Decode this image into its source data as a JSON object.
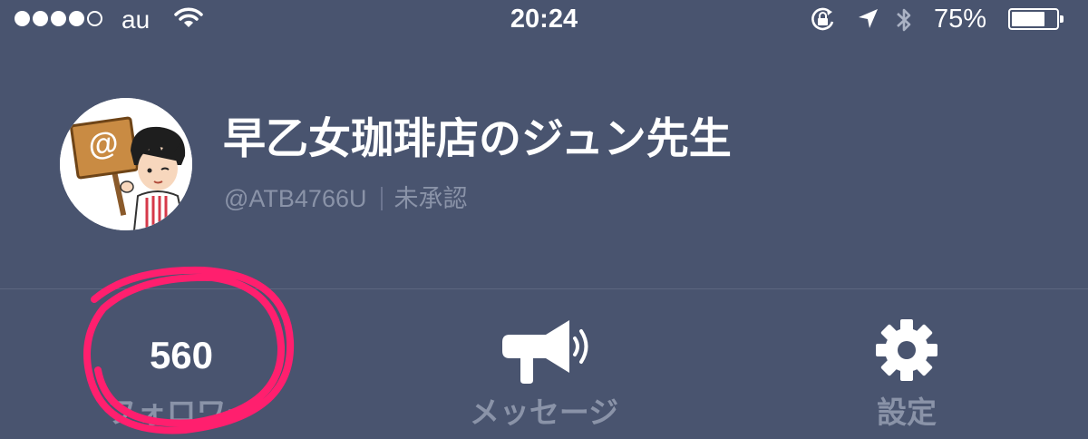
{
  "status_bar": {
    "carrier": "au",
    "time": "20:24",
    "battery_percent": "75%",
    "battery_level": 0.75,
    "signal_bars_filled": 4,
    "signal_bars_total": 5,
    "icons": [
      "wifi-icon",
      "rotation-lock-icon",
      "location-arrow-icon",
      "bluetooth-icon",
      "battery-icon"
    ]
  },
  "profile": {
    "name": "早乙女珈琲店のジュン先生",
    "account_id": "@ATB4766U",
    "status": "未承認",
    "avatar_badge": "@"
  },
  "stats": {
    "followers_count": "560",
    "followers_label": "フォロワー",
    "message_label": "メッセージ",
    "settings_label": "設定"
  },
  "colors": {
    "background": "#49546f",
    "muted_text": "#8a93a8",
    "annotation_circle": "#ff1f6e"
  }
}
